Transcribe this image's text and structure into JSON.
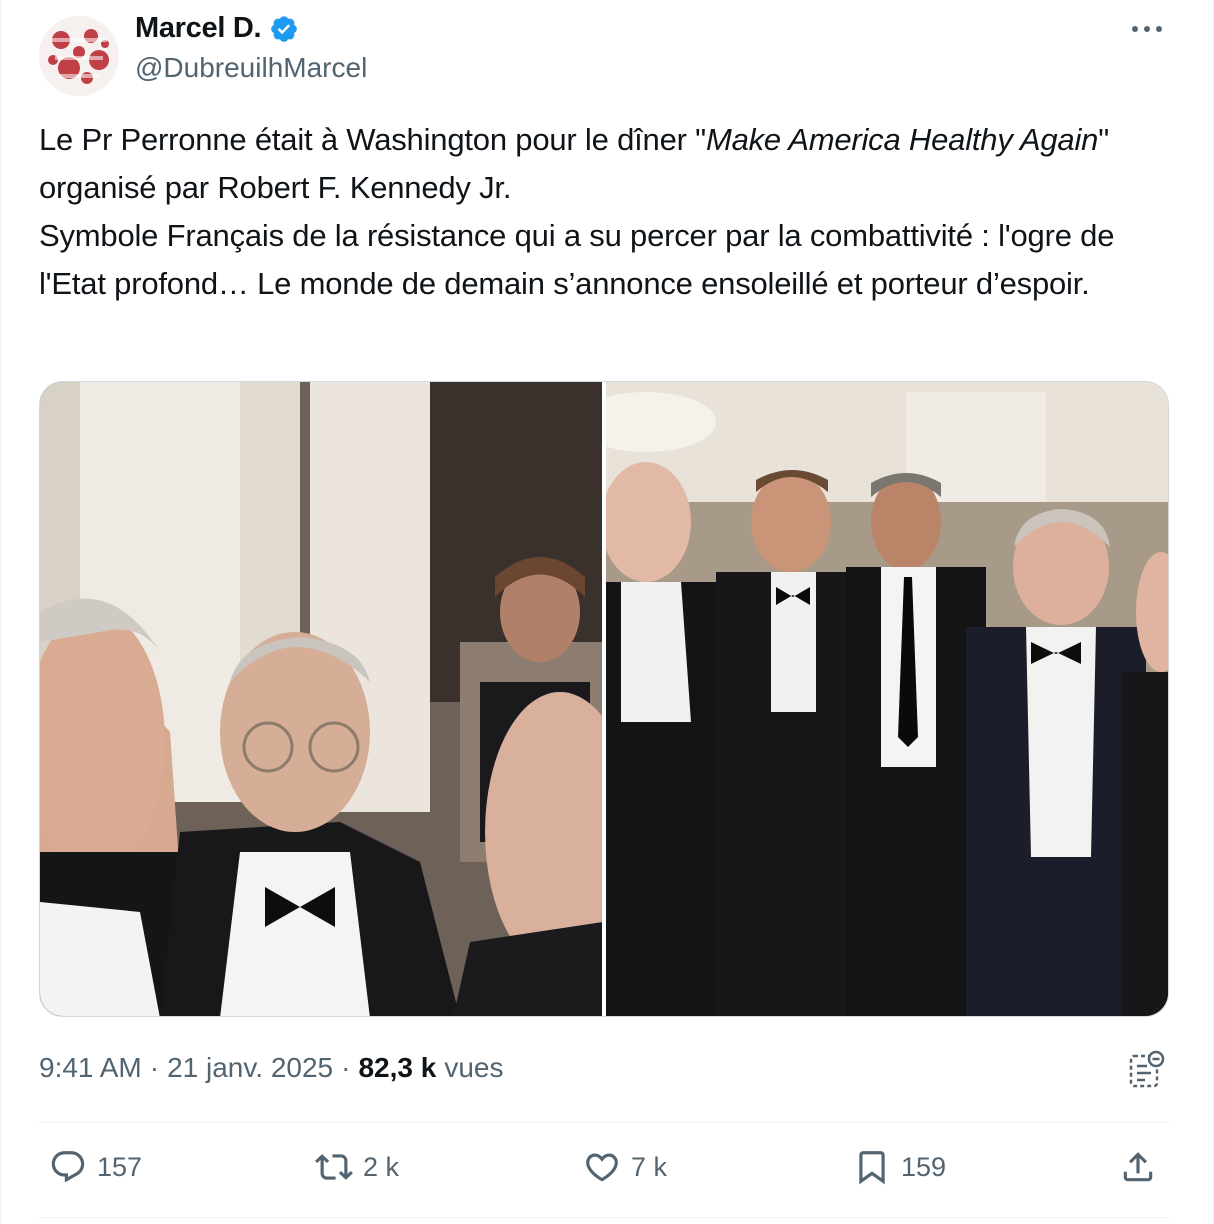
{
  "author": {
    "display_name": "Marcel D.",
    "handle": "@DubreuilhMarcel",
    "verified": true,
    "avatar_icon": "red-stamp-avatar"
  },
  "tweet": {
    "text_part1": "Le Pr Perronne était à Washington pour le dîner \"",
    "text_italic": "Make America Healthy Again",
    "text_part2": "\" organisé par Robert F. Kennedy Jr.",
    "text_line2": "Symbole Français de la résistance qui a su percer par la combattivité : l'ogre de l'Etat profond… Le monde de demain s’annonce ensoleillé et porteur d’espoir."
  },
  "media": [
    {
      "name": "photo-selfie-group",
      "description_icon": "photo"
    },
    {
      "name": "photo-four-men-tuxedos",
      "description_icon": "photo"
    }
  ],
  "meta": {
    "time": "9:41 AM",
    "separator": "·",
    "date": "21 janv. 2025",
    "views_count": "82,3 k",
    "views_label": "vues"
  },
  "actions": {
    "replies": "157",
    "reposts": "2 k",
    "likes": "7 k",
    "bookmarks": "159"
  },
  "colors": {
    "text": "#0f1419",
    "secondary": "#536471",
    "verified": "#1d9bf0",
    "border": "#cfd9de"
  }
}
